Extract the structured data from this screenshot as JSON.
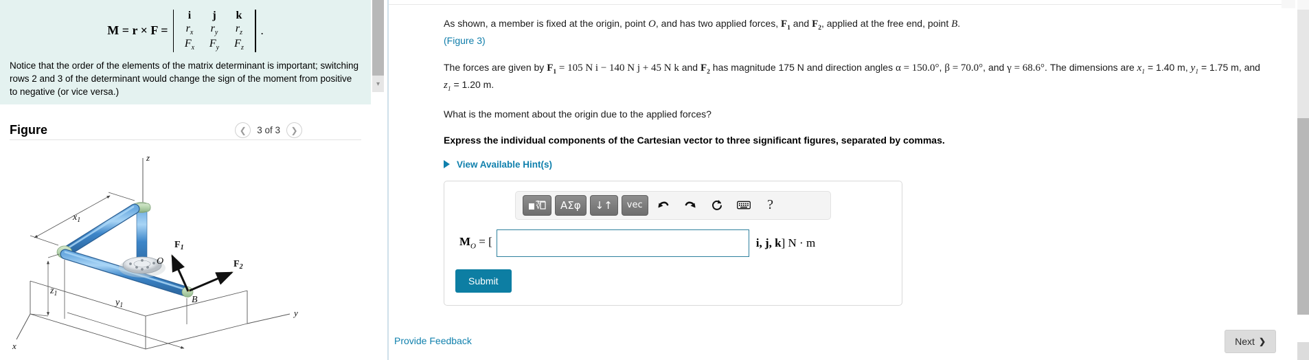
{
  "left_panel": {
    "hint_box": {
      "formula": {
        "lhs": "M = r × F =",
        "matrix_rows": [
          [
            "i",
            "j",
            "k"
          ],
          [
            "rx",
            "ry",
            "rz"
          ],
          [
            "Fx",
            "Fy",
            "Fz"
          ]
        ],
        "trailing_period": "."
      },
      "note": "Notice that the order of the elements of the matrix determinant is important; switching rows 2 and 3 of the determinant would change the sign of the moment from positive to negative (or vice versa.)"
    },
    "figure": {
      "title": "Figure",
      "pager": {
        "prev_icon": "chevron-left-icon",
        "counter": "3 of 3",
        "next_icon": "chevron-right-icon"
      },
      "diagram": {
        "axis_labels": {
          "x": "x",
          "y": "y",
          "z": "z"
        },
        "dimension_labels": {
          "x1": "x",
          "x1_sub": "1",
          "y1": "y",
          "y1_sub": "1",
          "z1": "z",
          "z1_sub": "1"
        },
        "point_labels": {
          "origin": "O",
          "free_end": "B"
        },
        "force_labels": {
          "f1": "F",
          "f1_sub": "1",
          "f2": "F",
          "f2_sub": "2"
        },
        "colors": {
          "pipe": "#4a90d9",
          "pipe_light": "#8fc4ee",
          "joint": "#b6d4ae",
          "force_arrow": "#000000"
        }
      }
    },
    "scrollbar": {
      "collapse_icon": "chevron-down-icon"
    }
  },
  "main": {
    "problem": {
      "intro_1": "As shown, a member is fixed at the origin, point ",
      "intro_origin": "O",
      "intro_2": ", and has two applied forces, ",
      "f1": "F",
      "f1_sub": "1",
      "intro_3": " and ",
      "f2": "F",
      "f2_sub": "2",
      "intro_4": ", applied at the free end, point ",
      "intro_B": "B",
      "intro_5": ".",
      "figure_link": "(Figure 3)",
      "forces_1": "The forces are given by ",
      "forces_f1": "F",
      "forces_f1_sub": "1",
      "forces_eq": " = 105 N i − 140 N j + 45 N k",
      "forces_2": " and ",
      "forces_f2": "F",
      "forces_f2_sub": "2",
      "forces_3": " has magnitude 175 N and direction angles ",
      "alpha": "α = 150.0°",
      "sep1": ", ",
      "beta": "β = 70.0°",
      "sep2": ", and ",
      "gamma": "γ = 68.6°",
      "forces_4": ". The dimensions are ",
      "x1": "x",
      "x1_sub": "1",
      "x1_val": " = 1.40 m, ",
      "y1": "y",
      "y1_sub": "1",
      "y1_val": " = 1.75 m, and ",
      "z1": "z",
      "z1_sub": "1",
      "z1_val": " = 1.20 m.",
      "question": "What is the moment about the origin due to the applied forces?",
      "instruction": "Express the individual components of the Cartesian vector to three significant figures, separated by commas."
    },
    "hints": {
      "label": "View Available Hint(s)",
      "triangle_icon": "triangle-right-icon"
    },
    "answer": {
      "toolbar": {
        "template_button": "template-icon",
        "template_glyph": "■√☐",
        "greek_button": "ΑΣφ",
        "arrows_button": "↓↑",
        "vec_button": "vec",
        "undo_icon": "undo-icon",
        "undo_glyph": "↰",
        "redo_icon": "redo-icon",
        "redo_glyph": "↱",
        "reset_icon": "reset-icon",
        "reset_glyph": "↻",
        "keyboard_icon": "keyboard-icon",
        "keyboard_glyph": "⌨",
        "help_icon": "help-icon",
        "help_glyph": "?"
      },
      "lhs_label": "M",
      "lhs_sub": "O",
      "lhs_eq": " = [",
      "input_value": "",
      "input_placeholder": "",
      "rhs_units": "i, j, k] N · m",
      "submit_label": "Submit"
    },
    "footer": {
      "feedback_label": "Provide Feedback",
      "next_label": "Next",
      "next_icon": "chevron-right-icon",
      "next_glyph": "❯"
    }
  },
  "colors": {
    "accent_teal": "#0d7ea3",
    "link_blue": "#1080ad",
    "hint_bg": "#e4f2f0",
    "input_border": "#2d7f9d"
  }
}
